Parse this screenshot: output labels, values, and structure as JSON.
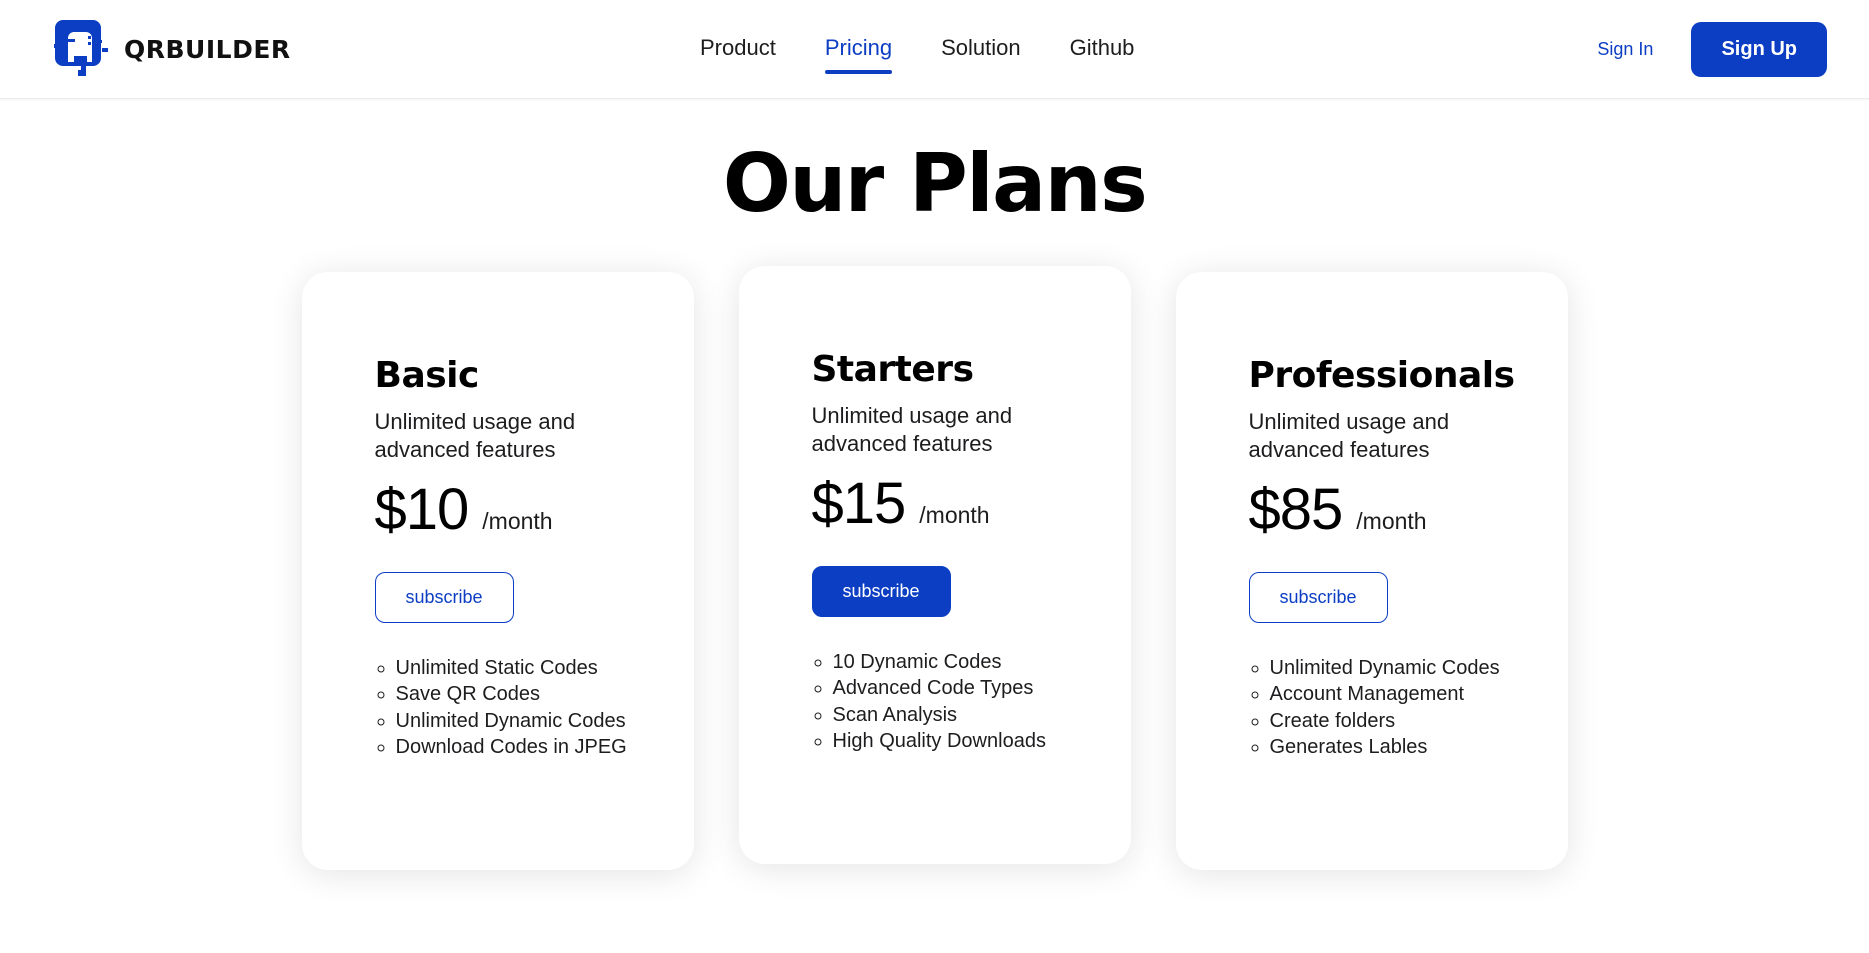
{
  "header": {
    "brand": {
      "name": "QRBUILDER",
      "logo_icon": "qr-q-logo-icon",
      "color": "#0c3ec4"
    },
    "nav": [
      {
        "label": "Product",
        "active": false
      },
      {
        "label": "Pricing",
        "active": true
      },
      {
        "label": "Solution",
        "active": false
      },
      {
        "label": "Github",
        "active": false
      }
    ],
    "sign_in_label": "Sign In",
    "sign_up_label": "Sign Up"
  },
  "main": {
    "title": "Our Plans",
    "plans": [
      {
        "name": "Basic",
        "description": "Unlimited usage and advanced features",
        "price": "$10",
        "period": "/month",
        "cta_label": "subscribe",
        "cta_style": "outline",
        "features": [
          "Unlimited Static Codes",
          "Save QR Codes",
          "Unlimited Dynamic Codes",
          "Download Codes in JPEG"
        ]
      },
      {
        "name": "Starters",
        "description": "Unlimited usage and advanced features",
        "price": "$15",
        "period": "/month",
        "cta_label": "subscribe",
        "cta_style": "filled",
        "features": [
          "10 Dynamic Codes",
          "Advanced Code Types",
          "Scan Analysis",
          "High Quality Downloads"
        ]
      },
      {
        "name": "Professionals",
        "description": "Unlimited usage and advanced features",
        "price": "$85",
        "period": "/month",
        "cta_label": "subscribe",
        "cta_style": "outline",
        "features": [
          "Unlimited Dynamic Codes",
          "Account Management",
          "Create folders",
          "Generates Lables"
        ]
      }
    ]
  },
  "colors": {
    "accent": "#0c3ec4",
    "text": "#1d1d1f",
    "background": "#ffffff"
  }
}
